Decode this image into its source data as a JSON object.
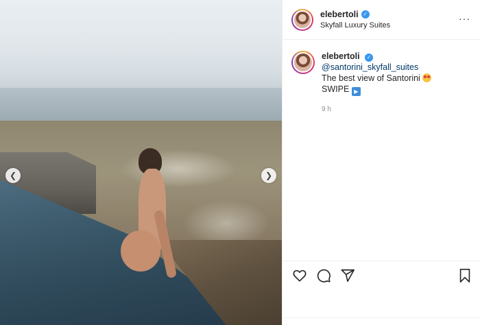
{
  "post": {
    "username": "elebertoli",
    "location": "Skyfall Luxury Suites",
    "caption": {
      "username": "elebertoli",
      "mention": "@santorini_skyfall_suites",
      "line1": "The best view of Santorini",
      "line2": "SWIPE",
      "time": "9 h"
    }
  },
  "icons": {
    "verified": "verified-badge-icon",
    "prev": "chevron-left-icon",
    "next": "chevron-right-icon",
    "like": "heart-icon",
    "comment": "comment-icon",
    "share": "share-icon",
    "save": "bookmark-icon"
  },
  "colors": {
    "verified": "#3897f0",
    "mention": "#00376b"
  }
}
